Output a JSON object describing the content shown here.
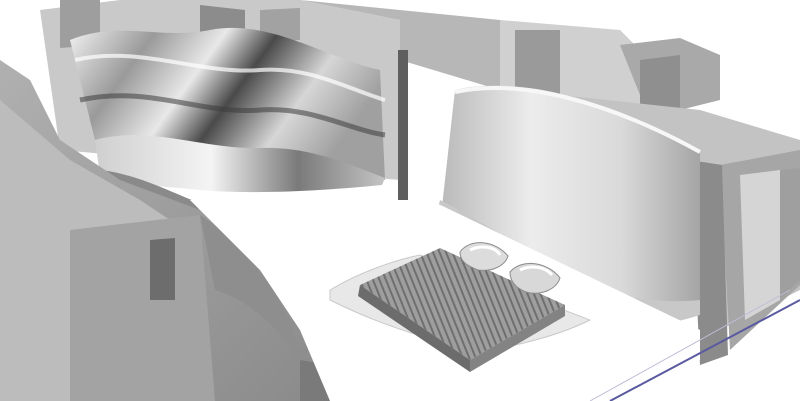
{
  "scene": {
    "subject": "3d-render-curved-bedroom-walls",
    "palette": {
      "background": "#ffffff",
      "wall_light": "#d2d2d2",
      "wall_mid": "#a8a8a8",
      "wall_dark": "#6e6e6e",
      "floor_edge": "#5a5aa0"
    }
  }
}
